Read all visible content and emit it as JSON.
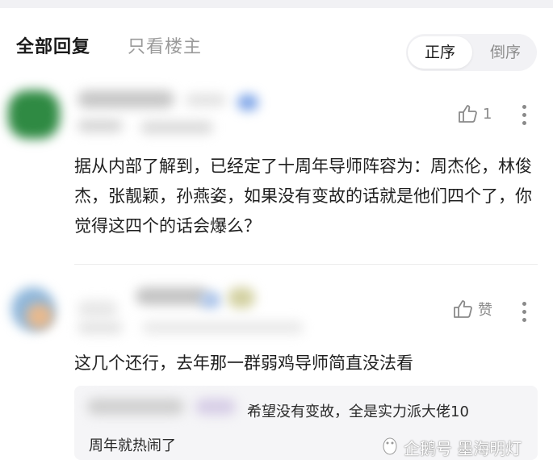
{
  "tabs": {
    "all_replies": "全部回复",
    "only_op": "只看楼主"
  },
  "sort": {
    "ascending": "正序",
    "descending": "倒序"
  },
  "comments": [
    {
      "like_count": "1",
      "text": "据从内部了解到，已经定了十周年导师阵容为：周杰伦，林俊杰，张靓颖，孙燕姿，如果没有变故的话就是他们四个了，你觉得这四个的话会爆么？"
    },
    {
      "like_label": "赞",
      "text": "这几个还行，去年那一群弱鸡导师简直没法看",
      "reply": {
        "text_line1": "希望没有变故，全是实力派大佬10",
        "text_line2": "周年就热闹了"
      }
    }
  ],
  "watermark": "企鹅号 墨海明灯",
  "colors": {
    "text_primary": "#1f1f1f",
    "text_muted": "#9a9a9a",
    "reply_bg": "#f5f5f7",
    "sort_bg": "#f2f2f5"
  }
}
